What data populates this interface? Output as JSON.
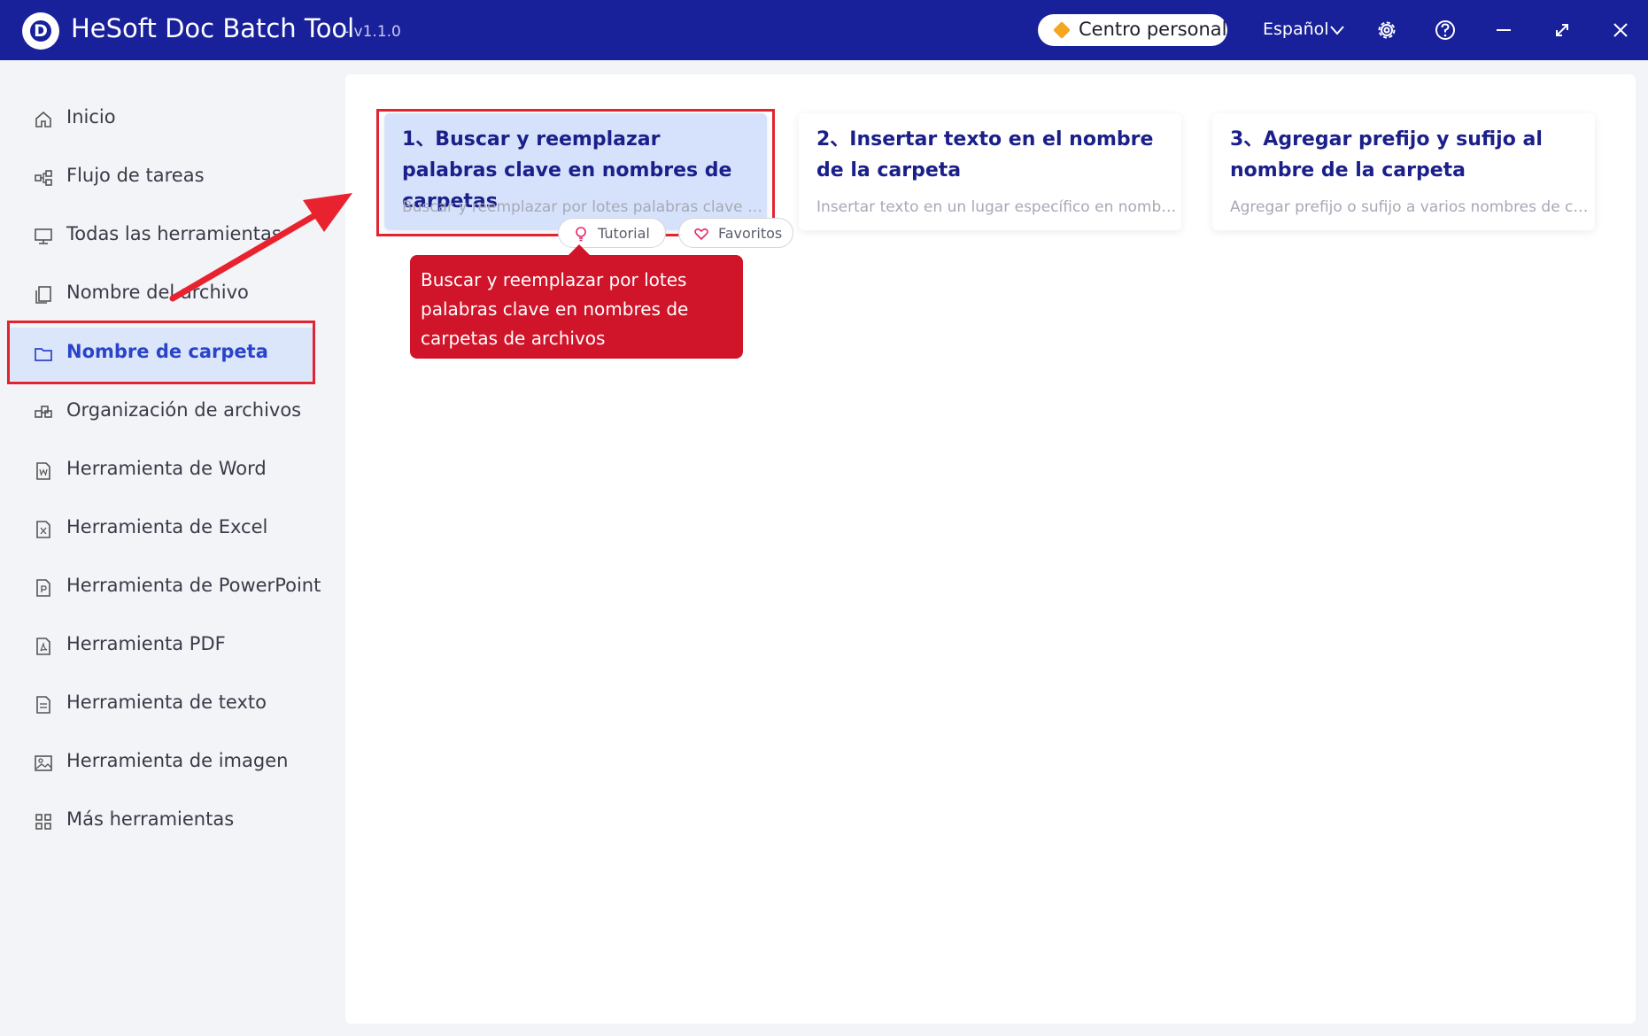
{
  "app": {
    "logo_letter": "D",
    "title": "HeSoft Doc Batch Tool",
    "version": "- v1.1.0",
    "personal_center": "Centro personal",
    "language": "Español"
  },
  "sidebar": {
    "items": [
      {
        "label": "Inicio",
        "icon": "home-icon"
      },
      {
        "label": "Flujo de tareas",
        "icon": "workflow-icon"
      },
      {
        "label": "Todas las herramientas",
        "icon": "monitor-icon"
      },
      {
        "label": "Nombre del archivo",
        "icon": "file-copy-icon"
      },
      {
        "label": "Nombre de carpeta",
        "icon": "folder-icon",
        "active": true
      },
      {
        "label": "Organización de archivos",
        "icon": "organize-icon"
      },
      {
        "label": "Herramienta de Word",
        "icon": "word-file-icon"
      },
      {
        "label": "Herramienta de Excel",
        "icon": "excel-file-icon"
      },
      {
        "label": "Herramienta de PowerPoint",
        "icon": "powerpoint-file-icon"
      },
      {
        "label": "Herramienta PDF",
        "icon": "pdf-file-icon"
      },
      {
        "label": "Herramienta de texto",
        "icon": "text-file-icon"
      },
      {
        "label": "Herramienta de imagen",
        "icon": "image-icon"
      },
      {
        "label": "Más herramientas",
        "icon": "grid-icon"
      }
    ]
  },
  "cards": [
    {
      "title": "1、Buscar y reemplazar palabras clave en nombres de carpetas",
      "desc": "Buscar y reemplazar por lotes palabras clave en n..."
    },
    {
      "title": "2、Insertar texto en el nombre de la carpeta",
      "desc": "Insertar texto en un lugar específico en nombres ..."
    },
    {
      "title": "3、Agregar prefijo y sufijo al nombre de la carpeta",
      "desc": "Agregar prefijo o sufijo a varios nombres de carp..."
    }
  ],
  "chips": {
    "tutorial": "Tutorial",
    "favorites": "Favoritos"
  },
  "tooltip": "Buscar y reemplazar por lotes palabras clave en nombres de carpetas de archivos",
  "colors": {
    "titlebar": "#18209a",
    "accent": "#2a44c9",
    "highlight": "#e02430",
    "tooltip": "#d0142a"
  }
}
